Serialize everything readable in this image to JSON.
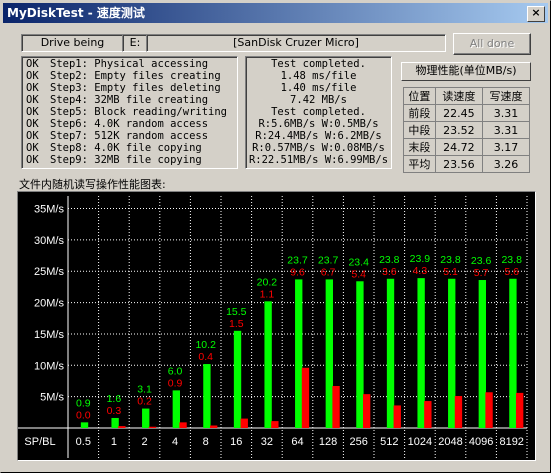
{
  "window": {
    "title": "MyDiskTest - 速度测试",
    "close_label": "×"
  },
  "drive": {
    "name": "Drive being",
    "letter": "E:",
    "model": "[SanDisk Cruzer Micro]"
  },
  "all_done_label": "All done",
  "steps": [
    {
      "status": "OK",
      "text": "Step1: Physical accessing"
    },
    {
      "status": "OK",
      "text": "Step2: Empty files creating"
    },
    {
      "status": "OK",
      "text": "Step3: Empty files deleting"
    },
    {
      "status": "OK",
      "text": "Step4: 32MB file creating"
    },
    {
      "status": "OK",
      "text": "Step5: Block reading/writing"
    },
    {
      "status": "OK",
      "text": "Step6: 4.0K random access"
    },
    {
      "status": "OK",
      "text": "Step7: 512K random access"
    },
    {
      "status": "OK",
      "text": "Step8: 4.0K file copying"
    },
    {
      "status": "OK",
      "text": "Step9: 32MB file copying"
    }
  ],
  "results": [
    "Test completed.",
    "1.48 ms/file",
    "1.40 ms/file",
    "7.42 MB/s",
    "Test completed.",
    "R:5.6MB/s W:0.5MB/s",
    "R:24.4MB/s W:6.2MB/s",
    "R:0.57MB/s W:0.08MB/s",
    "R:22.51MB/s W:6.99MB/s"
  ],
  "speed_table": {
    "title": "物理性能(单位MB/s)",
    "headers": [
      "位置",
      "读速度",
      "写速度"
    ],
    "rows": [
      [
        "前段",
        "22.45",
        "3.31"
      ],
      [
        "中段",
        "23.52",
        "3.31"
      ],
      [
        "末段",
        "24.72",
        "3.17"
      ],
      [
        "平均",
        "23.56",
        "3.26"
      ]
    ]
  },
  "chart_caption": "文件内随机读写操作性能图表:",
  "chart_data": {
    "type": "bar",
    "title": "文件内随机读写操作性能图表:",
    "corner_label": "SP/BL",
    "categories": [
      "0.5",
      "1",
      "2",
      "4",
      "8",
      "16",
      "32",
      "64",
      "128",
      "256",
      "512",
      "1024",
      "2048",
      "4096",
      "8192"
    ],
    "series": [
      {
        "values": [
          0.9,
          1.6,
          3.1,
          6.0,
          10.2,
          15.5,
          20.2,
          23.7,
          23.7,
          23.4,
          23.8,
          23.9,
          23.8,
          23.6,
          23.8
        ],
        "color": "#00ff00"
      },
      {
        "values": [
          0.0,
          0.3,
          0.2,
          0.9,
          0.4,
          1.5,
          1.1,
          9.6,
          6.7,
          5.4,
          3.6,
          4.3,
          5.1,
          5.7,
          5.6
        ],
        "color": "#ff0000"
      }
    ],
    "y_ticks": [
      "5M/s",
      "10M/s",
      "15M/s",
      "20M/s",
      "25M/s",
      "30M/s",
      "35M/s"
    ],
    "y_tick_values": [
      5,
      10,
      15,
      20,
      25,
      30,
      35
    ],
    "ylim": [
      0,
      37
    ],
    "grid": true,
    "colors": {
      "background": "#000000",
      "grid": "#ffffff",
      "axis_text": "#ffffff",
      "read_label": "#00ff00",
      "write_label": "#ff0000"
    }
  }
}
